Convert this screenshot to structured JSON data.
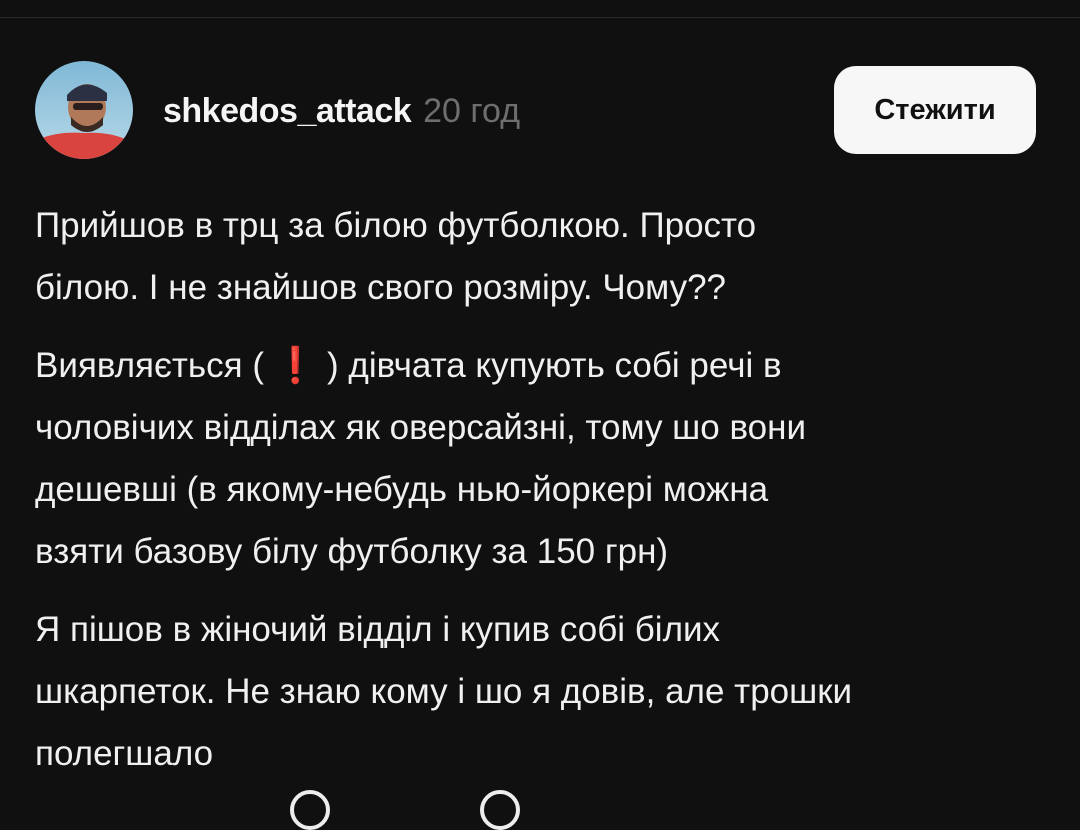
{
  "post": {
    "username": "shkedos_attack",
    "timestamp": "20 год",
    "follow_label": "Стежити",
    "paragraphs": [
      {
        "lines": [
          "Прийшов в трц за білою футболкою. Просто",
          "білою. І не знайшов свого розміру. Чому??"
        ]
      },
      {
        "line1_before": "Виявляється (",
        "line1_emoji": "❗",
        "line1_after": ") дівчата купують собі речі в",
        "lines": [
          "чоловічих відділах як оверсайзні, тому шо вони",
          "дешевші (в якому-небудь нью-йоркері можна",
          "взяти базову білу футболку за 150 грн)"
        ]
      },
      {
        "lines": [
          "Я пішов в жіночий відділ і купив собі білих",
          "шкарпеток. Не знаю кому і шо я довів, але трошки",
          "полегшало"
        ]
      }
    ]
  },
  "icons": {
    "avatar": "user-avatar-photo",
    "bottom": [
      "like-icon",
      "comment-icon"
    ]
  },
  "colors": {
    "background": "#101010",
    "text": "#f0f0f0",
    "timestamp": "#6e6e6e",
    "follow_button_bg": "#f7f7f7",
    "emoji_red": "#e0352b"
  }
}
